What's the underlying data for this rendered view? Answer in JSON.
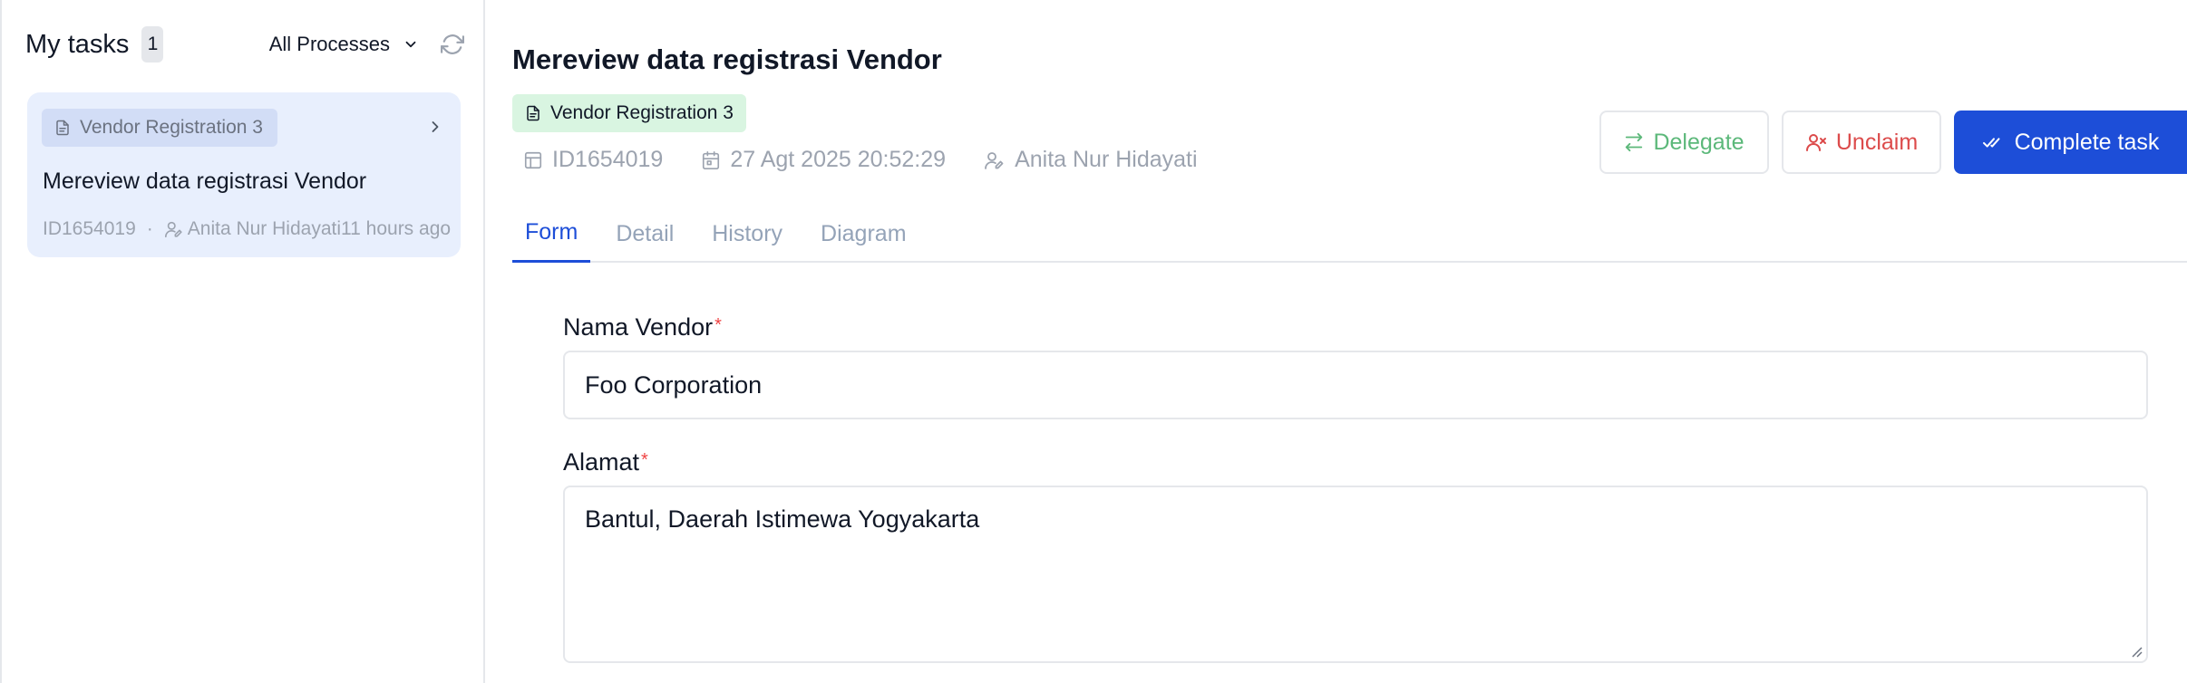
{
  "sidebar": {
    "title": "My tasks",
    "count": "1",
    "filter": {
      "selected": "All Processes"
    },
    "tasks": [
      {
        "process": "Vendor Registration 3",
        "title": "Mereview data registrasi Vendor",
        "id": "ID1654019",
        "separator": "·",
        "assignee": "Anita Nur Hidayati",
        "time": "11 hours ago"
      }
    ]
  },
  "task": {
    "title": "Mereview data registrasi Vendor",
    "process": "Vendor Registration 3",
    "id": "ID1654019",
    "date": "27 Agt 2025 20:52:29",
    "assignee": "Anita Nur Hidayati"
  },
  "actions": {
    "delegate": "Delegate",
    "unclaim": "Unclaim",
    "complete": "Complete task"
  },
  "tabs": [
    {
      "label": "Form",
      "active": true
    },
    {
      "label": "Detail"
    },
    {
      "label": "History"
    },
    {
      "label": "Diagram"
    }
  ],
  "form": {
    "fields": [
      {
        "label": "Nama Vendor",
        "required_mark": "*",
        "value": "Foo Corporation"
      },
      {
        "label": "Alamat",
        "required_mark": "*",
        "value": "Bantul, Daerah Istimewa Yogyakarta"
      }
    ]
  },
  "colors": {
    "primary": "#1d4ed8",
    "delegate": "#5cb87a",
    "unclaim": "#dc4b4b",
    "process_badge_bg": "#d9f5e1",
    "selected_card_bg": "#e8effd"
  },
  "icons": {
    "filter_chevron": "chevron-down-icon",
    "refresh": "refresh-icon",
    "document": "document-icon",
    "card_chevron": "chevron-right-icon",
    "user": "user-edit-icon",
    "id": "table-icon",
    "date": "calendar-icon",
    "delegate": "swap-icon",
    "unclaim": "user-x-icon",
    "complete": "check-double-icon"
  }
}
